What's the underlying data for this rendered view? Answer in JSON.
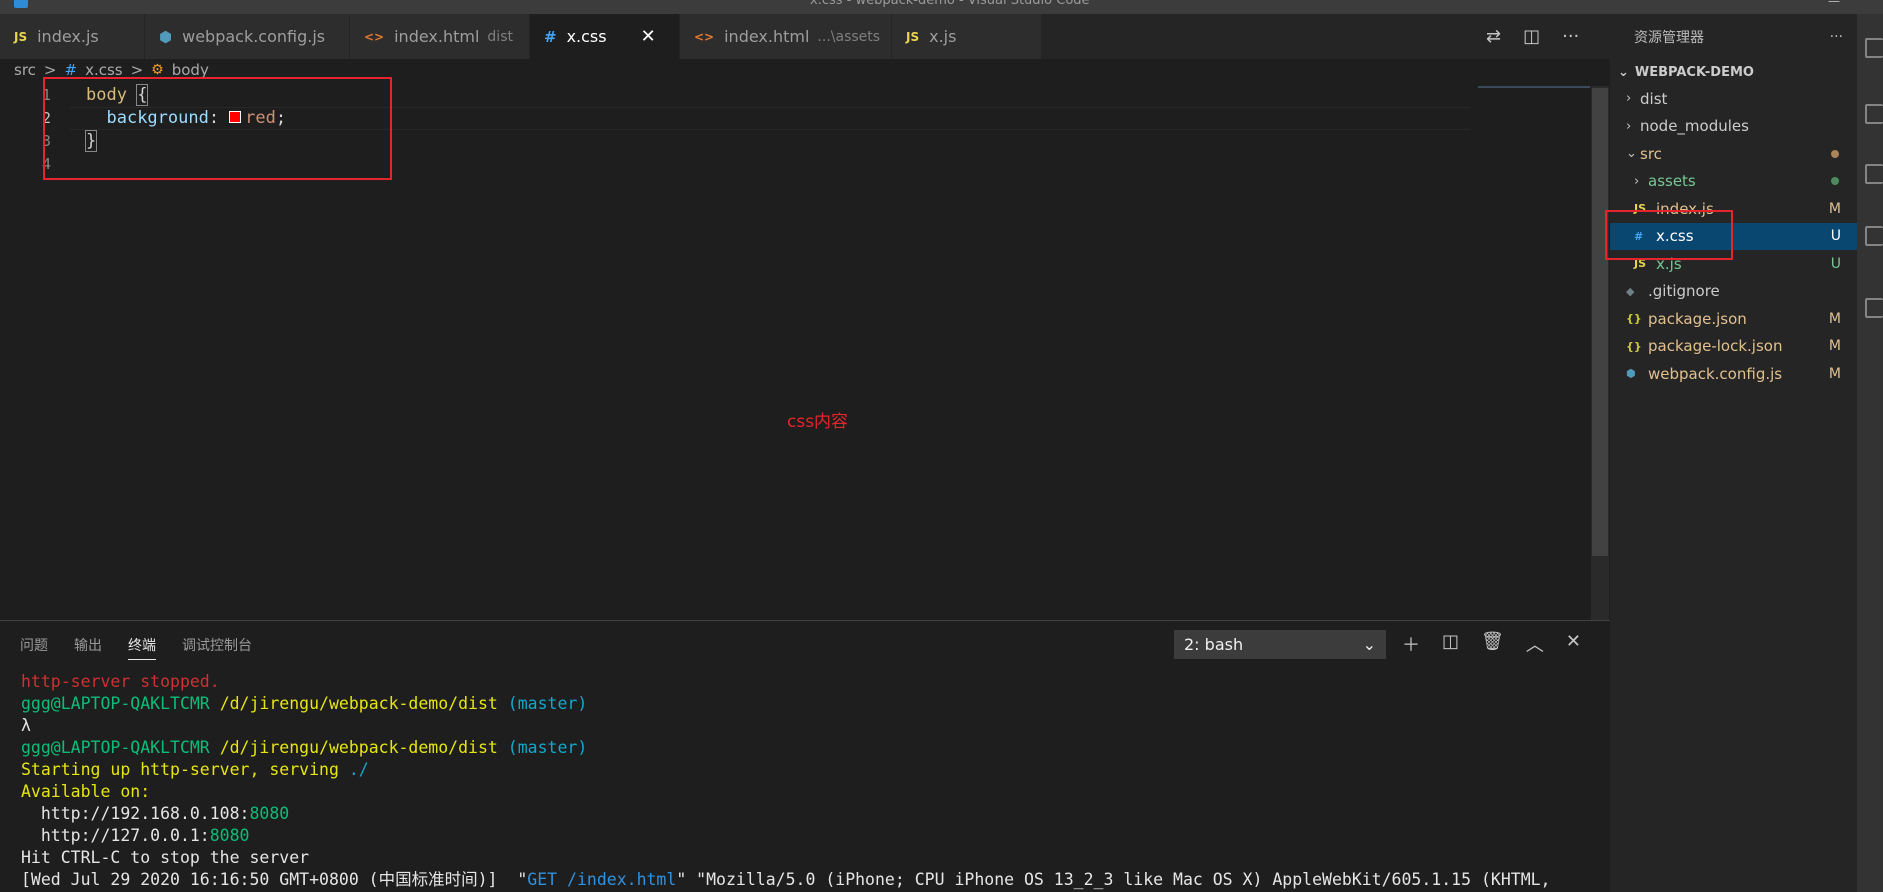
{
  "titlebar": {
    "title": "x.css - webpack-demo - Visual Studio Code",
    "icon": "vscode-icon"
  },
  "tabs": [
    {
      "icon": "JS",
      "label": "index.js",
      "sub": "",
      "active": false
    },
    {
      "icon": "⬢",
      "label": "webpack.config.js",
      "sub": "",
      "active": false
    },
    {
      "icon": "<>",
      "label": "index.html",
      "sub": "dist",
      "active": false
    },
    {
      "icon": "#",
      "label": "x.css",
      "sub": "",
      "active": true,
      "close": "✕"
    },
    {
      "icon": "<>",
      "label": "index.html",
      "sub": "...\\assets",
      "active": false
    },
    {
      "icon": "JS",
      "label": "x.js",
      "sub": "",
      "active": false
    }
  ],
  "editor_actions": [
    "compare-icon",
    "split-editor-icon",
    "more-icon"
  ],
  "breadcrumb": {
    "folder": "src",
    "sep": ">",
    "file_icon": "#",
    "file": "x.css",
    "symbol_icon": "symbol-class-icon",
    "symbol": "body"
  },
  "editor": {
    "line_numbers": [
      "1",
      "2",
      "3",
      "4"
    ],
    "line1": {
      "selector": "body",
      "brace": "{"
    },
    "line2": {
      "indent": "  ",
      "property": "background",
      "colon": ":",
      "swatch_color": "#ff0000",
      "value": "red",
      "semi": ";"
    },
    "line3": {
      "brace": "}"
    },
    "annotation": "css内容"
  },
  "panel": {
    "tabs": [
      "问题",
      "输出",
      "终端",
      "调试控制台"
    ],
    "active_tab": "终端",
    "terminal_select": "2: bash",
    "terminal": {
      "l1": "http-server stopped.",
      "l2_user": "ggg@LAPTOP-QAKLTCMR",
      "l2_path": "/d/jirengu/webpack-demo/dist",
      "l2_branch": "(master)",
      "l3": "λ",
      "l4_user": "ggg@LAPTOP-QAKLTCMR",
      "l4_path": "/d/jirengu/webpack-demo/dist",
      "l4_branch": "(master)",
      "l5_a": "Starting up http-server, serving ",
      "l5_b": "./",
      "l6": "Available on:",
      "l7_a": "  http://192.168.0.108:",
      "l7_b": "8080",
      "l8_a": "  http://127.0.0.1:",
      "l8_b": "8080",
      "l9": "Hit CTRL-C to stop the server",
      "l10_a": "[Wed Jul 29 2020 16:16:50 GMT+0800 (中国标准时间)]  \"",
      "l10_b": "GET /index.html",
      "l10_c": "\" \"Mozilla/5.0 (iPhone; CPU iPhone OS 13_2_3 like Mac OS X) AppleWebKit/605.1.15 (KHTML,"
    }
  },
  "explorer": {
    "title": "资源管理器",
    "more": "···",
    "section": "WEBPACK-DEMO",
    "items": [
      {
        "type": "folder",
        "label": "dist",
        "expanded": false,
        "depth": 0,
        "badge": "",
        "color": "#cccccc"
      },
      {
        "type": "folder",
        "label": "node_modules",
        "expanded": false,
        "depth": 0,
        "badge": "",
        "color": "#cccccc"
      },
      {
        "type": "folder",
        "label": "src",
        "expanded": true,
        "depth": 0,
        "badge": "",
        "dot": "#a9855a",
        "color": "#e2c08d"
      },
      {
        "type": "folder",
        "label": "assets",
        "expanded": false,
        "depth": 1,
        "badge": "",
        "dot": "#4f8a5e",
        "color": "#73c991"
      },
      {
        "type": "file",
        "icon": "JS",
        "label": "index.js",
        "depth": 1,
        "badge": "M",
        "color": "#e2c08d"
      },
      {
        "type": "file",
        "icon": "#",
        "label": "x.css",
        "depth": 1,
        "badge": "U",
        "color": "#ffffff",
        "selected": true
      },
      {
        "type": "file",
        "icon": "JS",
        "label": "x.js",
        "depth": 1,
        "badge": "U",
        "color": "#73c991"
      },
      {
        "type": "file",
        "icon": "◆",
        "label": ".gitignore",
        "depth": 0,
        "badge": "",
        "color": "#cccccc"
      },
      {
        "type": "file",
        "icon": "{}",
        "label": "package.json",
        "depth": 0,
        "badge": "M",
        "color": "#e2c08d"
      },
      {
        "type": "file",
        "icon": "{}",
        "label": "package-lock.json",
        "depth": 0,
        "badge": "M",
        "color": "#e2c08d"
      },
      {
        "type": "file",
        "icon": "⬢",
        "label": "webpack.config.js",
        "depth": 0,
        "badge": "M",
        "color": "#e2c08d"
      }
    ]
  },
  "colors": {
    "accent_red": "#e5242b",
    "selection": "#094771",
    "modified": "#e2c08d",
    "untracked": "#73c991"
  }
}
